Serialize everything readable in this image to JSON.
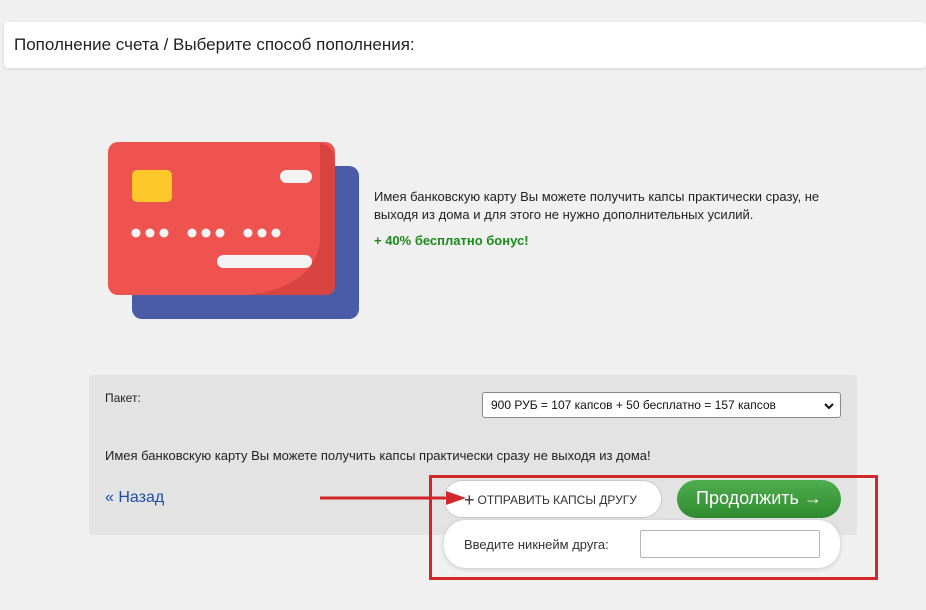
{
  "header": {
    "title": "Пополнение счета / Выберите способ пополнения:"
  },
  "promo": {
    "illustration_icon": "bank-card-icon",
    "description": "Имея банковскую карту Вы можете получить капсы практически сразу, не выходя из дома и для этого не нужно дополнительных усилий.",
    "bonus": "+ 40% бесплатно бонус!"
  },
  "form": {
    "package_label": "Пакет:",
    "package_selected": "900 РУБ = 107 капсов + 50 бесплатно = 157 капсов",
    "note": "Имея банковскую карту Вы можете получить капсы практически сразу не выходя из дома!",
    "back_label": "« Назад",
    "send_friend_label": "ОТПРАВИТЬ КАПСЫ ДРУГУ",
    "continue_label": "Продолжить →",
    "friend_nickname_label": "Введите никнейм друга:",
    "friend_nickname_value": ""
  },
  "colors": {
    "card_front": "#ef5350",
    "card_back": "#4a5ca8",
    "chip": "#fcc82a",
    "accent_green": "#3a9a3a",
    "bonus_text": "#1a8a1a",
    "link": "#1d4fa8",
    "annotation_red": "#d2262a"
  }
}
